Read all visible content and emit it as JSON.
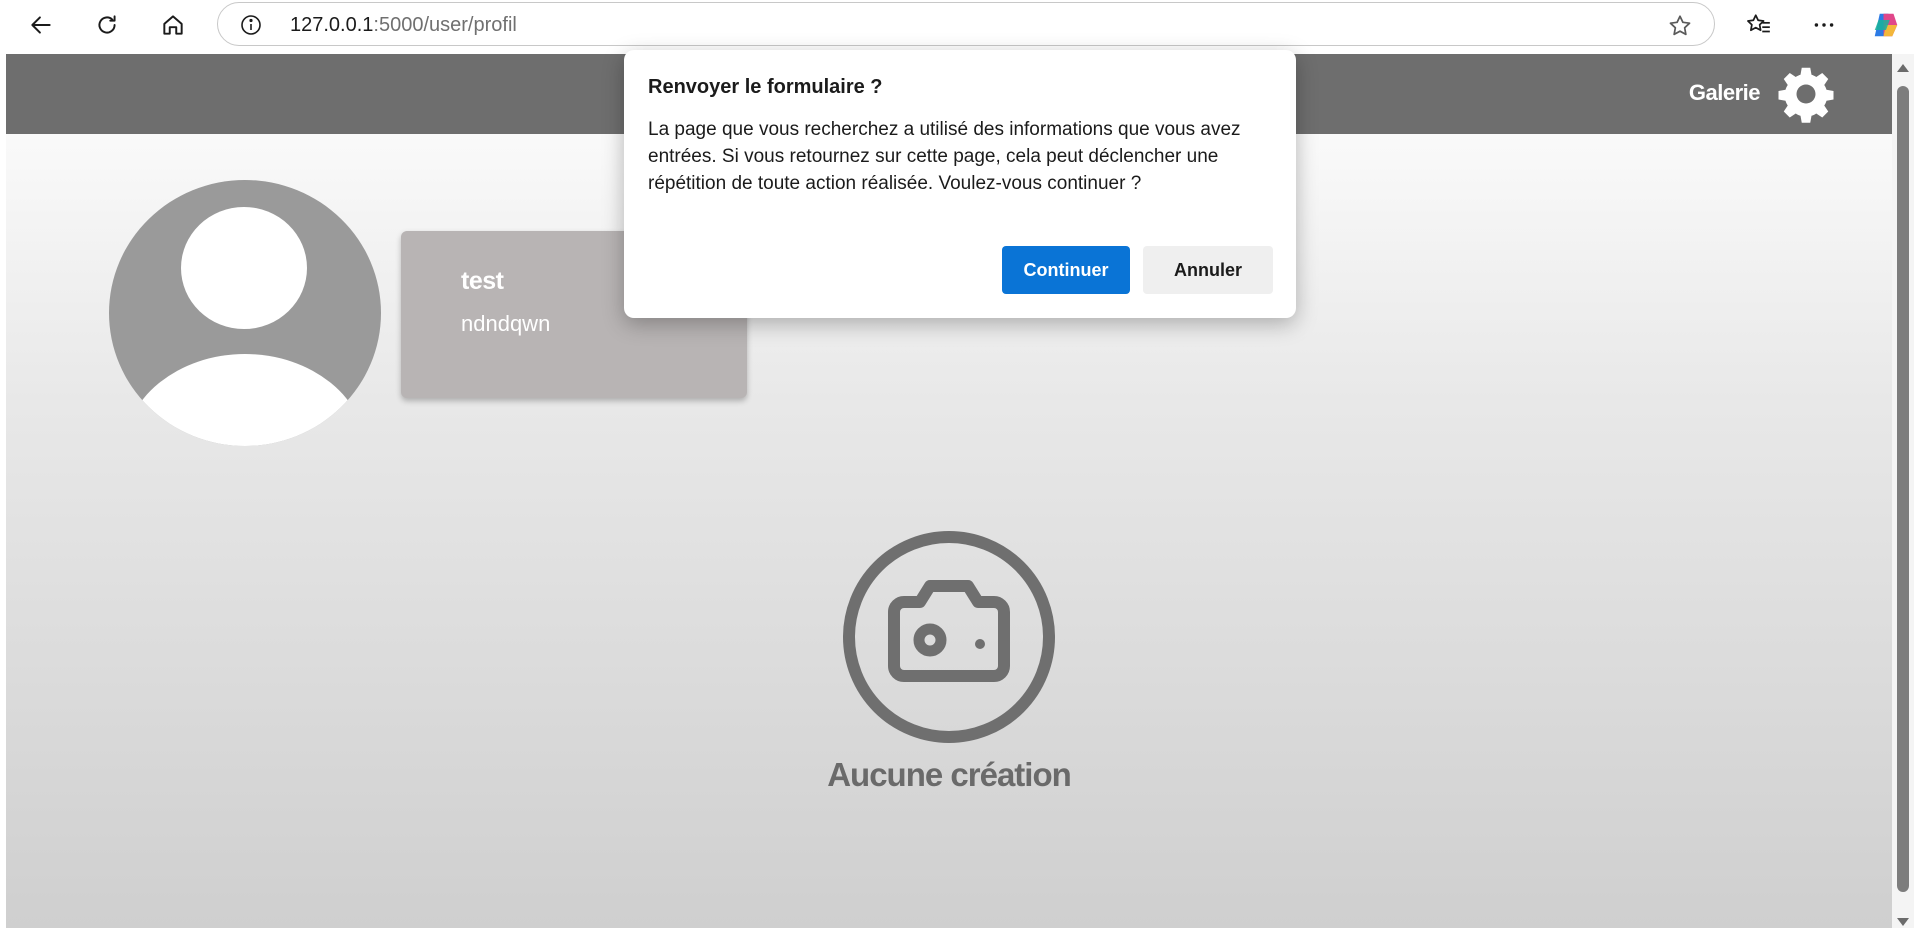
{
  "browser": {
    "url_host": "127.0.0.1",
    "url_path": ":5000/user/profil"
  },
  "header": {
    "gallery_label": "Galerie"
  },
  "profile": {
    "name": "test",
    "description": "ndndqwn"
  },
  "empty_state": {
    "label": "Aucune création"
  },
  "dialog": {
    "title": "Renvoyer le formulaire ?",
    "message": "La page que vous recherchez a utilisé des informations que vous avez entrées. Si vous retournez sur cette page, cela peut déclencher une répétition de toute action réalisée. Voulez-vous continuer ?",
    "continue_label": "Continuer",
    "cancel_label": "Annuler"
  },
  "colors": {
    "header_bg": "#6e6e6e",
    "primary_button": "#0a74d6",
    "card_bg": "#b8b4b4"
  }
}
